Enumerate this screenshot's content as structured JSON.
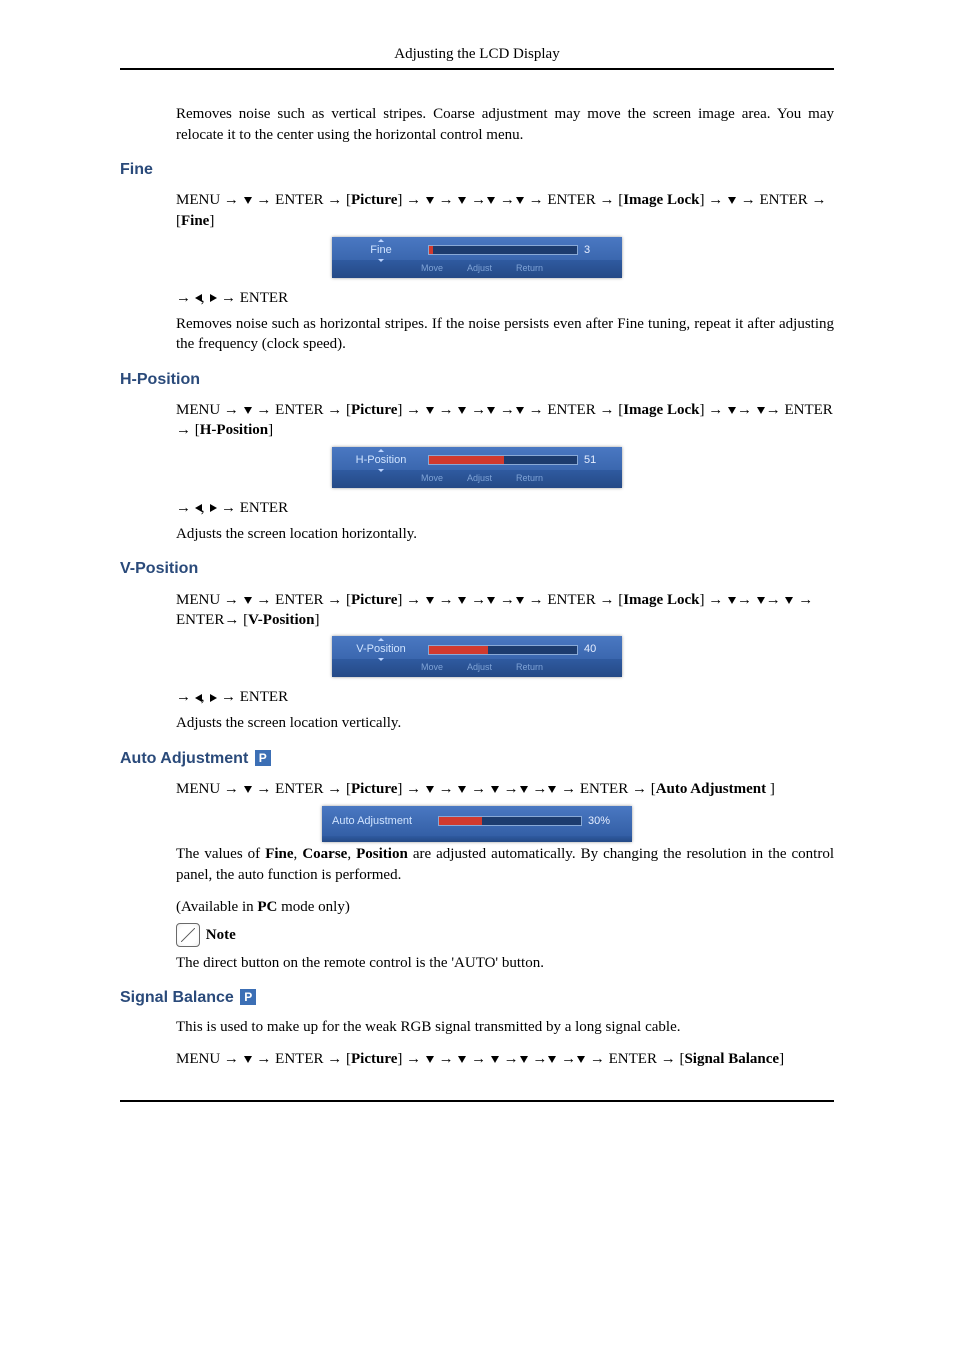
{
  "header": {
    "title": "Adjusting the LCD Display"
  },
  "intro_para": "Removes noise such as vertical stripes. Coarse adjustment may move the screen image area. You may relocate it to the center using the horizontal control menu.",
  "fine": {
    "heading": "Fine",
    "nav": {
      "menu": "MENU",
      "enter": "ENTER",
      "picture": "Picture",
      "imglock": "Image Lock",
      "final": "Fine"
    },
    "osd": {
      "label": "Fine",
      "value": "3",
      "fill_pct": 3,
      "hints": {
        "move": "Move",
        "adjust": "Adjust",
        "return": "Return"
      }
    },
    "post_nav_enter": "ENTER",
    "desc": "Removes noise such as horizontal stripes. If the noise persists even after Fine tuning, repeat it after adjusting the frequency (clock speed)."
  },
  "hpos": {
    "heading": "H-Position",
    "nav": {
      "menu": "MENU",
      "enter": "ENTER",
      "picture": "Picture",
      "imglock": "Image Lock",
      "final": "H-Position"
    },
    "osd": {
      "label": "H-Position",
      "value": "51",
      "fill_pct": 51,
      "hints": {
        "move": "Move",
        "adjust": "Adjust",
        "return": "Return"
      }
    },
    "post_nav_enter": "ENTER",
    "desc": "Adjusts the screen location horizontally."
  },
  "vpos": {
    "heading": "V-Position",
    "nav": {
      "menu": "MENU",
      "enter": "ENTER",
      "picture": "Picture",
      "imglock": "Image Lock",
      "final": "V-Position"
    },
    "osd": {
      "label": "V-Position",
      "value": "40",
      "fill_pct": 40,
      "hints": {
        "move": "Move",
        "adjust": "Adjust",
        "return": "Return"
      }
    },
    "post_nav_enter": "ENTER",
    "desc": "Adjusts the screen location vertically."
  },
  "auto": {
    "heading": "Auto Adjustment",
    "badge": "P",
    "nav": {
      "menu": "MENU",
      "enter": "ENTER",
      "picture": "Picture",
      "final": "Auto Adjustment "
    },
    "osd": {
      "label": "Auto Adjustment",
      "value": "30%",
      "fill_pct": 30
    },
    "desc_pre": "The values of ",
    "desc_b1": "Fine",
    "desc_mid1": ", ",
    "desc_b2": "Coarse",
    "desc_mid2": ", ",
    "desc_b3": "Position",
    "desc_post": " are adjusted automatically. By changing the resolution in the control panel, the auto function is performed.",
    "avail_pre": "(Available in ",
    "avail_b": "PC",
    "avail_post": " mode only)",
    "note_label": "Note",
    "note_body": "The direct button on the remote control is the 'AUTO' button."
  },
  "sigbal": {
    "heading": "Signal Balance",
    "badge": "P",
    "intro": "This is used to make up for the weak RGB signal transmitted by a long signal cable.",
    "nav": {
      "menu": "MENU",
      "enter": "ENTER",
      "picture": "Picture",
      "final": "Signal Balance"
    }
  }
}
